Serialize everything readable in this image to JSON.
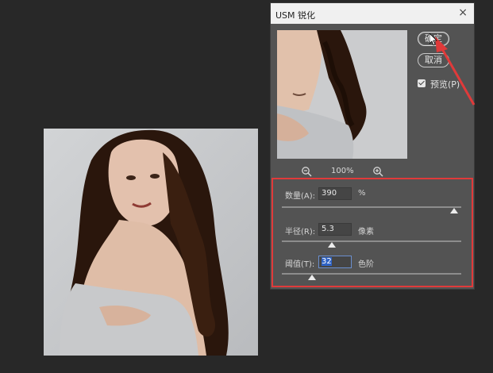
{
  "dialog": {
    "title": "USM 锐化",
    "close_label": "×",
    "ok_label": "确定",
    "cancel_label": "取消",
    "preview_label": "预览(P)",
    "preview_checked": true,
    "zoom_level": "100%"
  },
  "params": {
    "amount": {
      "label": "数量(A):",
      "value": "390",
      "unit": "%",
      "fraction": 0.96
    },
    "radius": {
      "label": "半径(R):",
      "value": "5.3",
      "unit": "像素",
      "fraction": 0.28
    },
    "threshold": {
      "label": "阈值(T):",
      "value": "32",
      "unit": "色阶",
      "fraction": 0.17
    }
  },
  "colors": {
    "background": "#282828",
    "dialog_bg": "#535353",
    "annotation_red": "#e03a3a",
    "selection_blue": "#2f63c5"
  },
  "icons": [
    "zoom-out-icon",
    "zoom-in-icon",
    "close-icon",
    "checkbox-icon",
    "arrow-annotation",
    "mouse-cursor-icon"
  ]
}
